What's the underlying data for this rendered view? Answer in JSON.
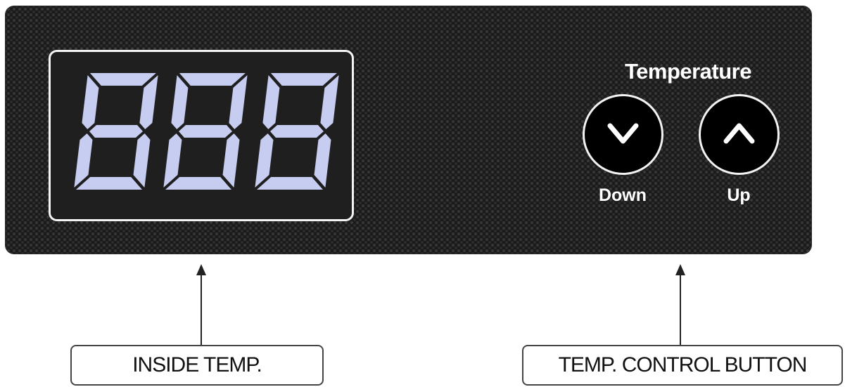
{
  "panel": {
    "display": {
      "digits": [
        "8",
        "8",
        "8"
      ],
      "segment_color": "#c7cdf0"
    },
    "controls": {
      "heading": "Temperature",
      "down_label": "Down",
      "up_label": "Up"
    }
  },
  "callouts": {
    "inside_temp": "INSIDE TEMP.",
    "temp_control": "TEMP. CONTROL BUTTON"
  }
}
